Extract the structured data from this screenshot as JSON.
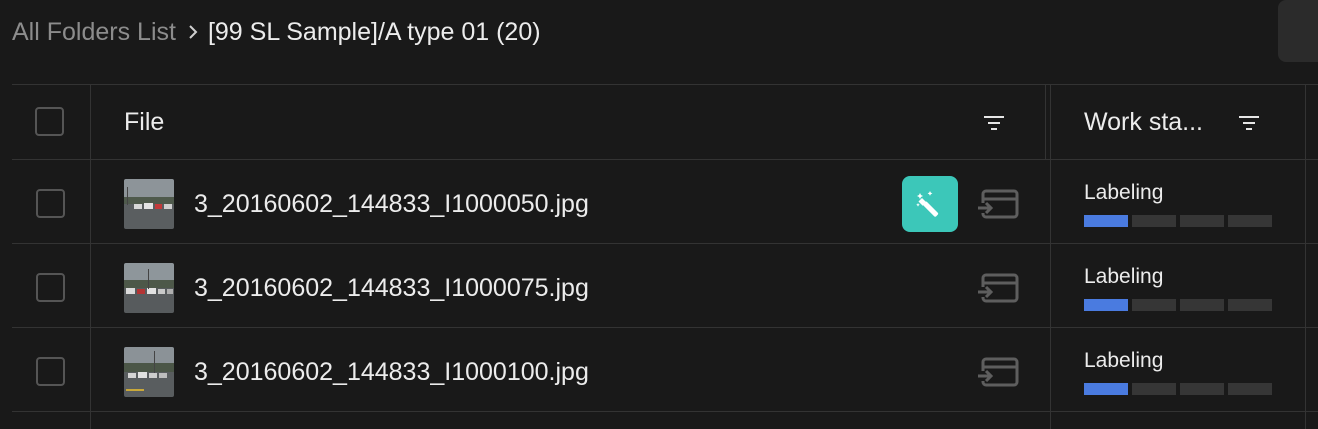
{
  "breadcrumb": {
    "root": "All Folders List",
    "current": "[99 SL Sample]/A type 01 (20)"
  },
  "table": {
    "columns": {
      "file": "File",
      "work_status": "Work sta..."
    },
    "rows": [
      {
        "file_name": "3_20160602_144833_I1000050.jpg",
        "status": "Labeling",
        "progress": 0.25,
        "show_auto_label": true
      },
      {
        "file_name": "3_20160602_144833_I1000075.jpg",
        "status": "Labeling",
        "progress": 0.25,
        "show_auto_label": false
      },
      {
        "file_name": "3_20160602_144833_I1000100.jpg",
        "status": "Labeling",
        "progress": 0.25,
        "show_auto_label": false
      }
    ]
  },
  "colors": {
    "background": "#191919",
    "accent_teal": "#3cc7b9",
    "progress_blue": "#4a7be0",
    "progress_empty": "#363636"
  },
  "icons": {
    "breadcrumb_separator": "chevron-right-icon",
    "column_filter": "filter-icon",
    "auto_label": "magic-wand-icon",
    "send": "send-to-icon"
  }
}
